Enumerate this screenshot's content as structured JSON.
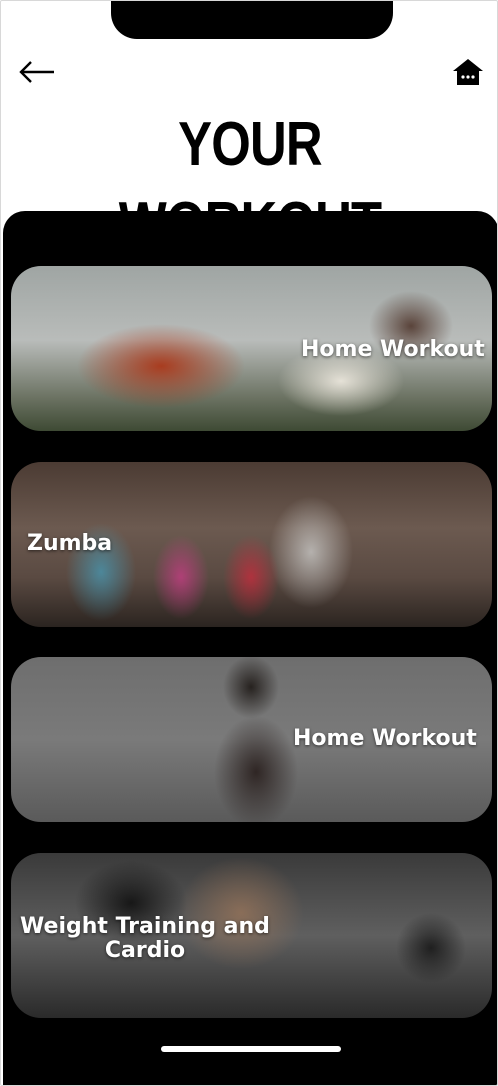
{
  "header": {
    "title": "YOUR WORKOUT",
    "back_icon": "arrow-left-icon",
    "home_icon": "home-icon"
  },
  "workouts": [
    {
      "label": "Home Workout"
    },
    {
      "label": "Zumba"
    },
    {
      "label": "Home Workout"
    },
    {
      "label": "Weight Training and Cardio"
    }
  ],
  "colors": {
    "background": "#ffffff",
    "panel": "#000000",
    "text_on_card": "#ffffff"
  }
}
